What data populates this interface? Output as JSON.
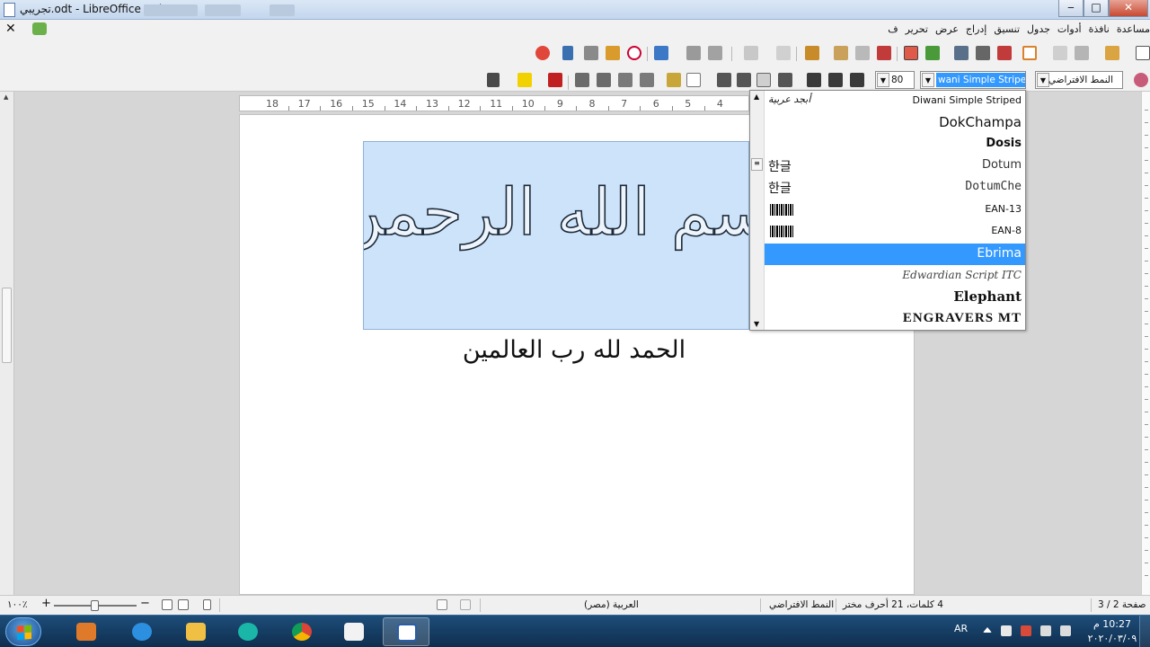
{
  "window": {
    "title": "تجريبي.odt - LibreOffice Writer",
    "min": "‒",
    "max": "□",
    "close": "✕"
  },
  "menu": {
    "close_doc": "✕",
    "items": [
      "ف",
      "تحرير",
      "عرض",
      "إدراج",
      "تنسيق",
      "جدول",
      "أدوات",
      "نافذة",
      "مساعدة"
    ]
  },
  "format_bar": {
    "paragraph_style": "النمط الافتراضي",
    "font_name": "wani Simple Striped",
    "font_size": "80"
  },
  "ruler": {
    "labels": [
      "18",
      "17",
      "16",
      "15",
      "14",
      "13",
      "12",
      "11",
      "10",
      "9",
      "8",
      "7",
      "6",
      "5",
      "4"
    ]
  },
  "document": {
    "frame_text": "بسم الله الرحمن الرحيم",
    "line2": "الحمد لله رب العالمين"
  },
  "font_dropdown": {
    "selected": "Ebrima",
    "items": [
      {
        "name": "Diwani Simple Striped",
        "sample": "أبجد عربية"
      },
      {
        "name": "DokChampa",
        "sample": ""
      },
      {
        "name": "Dosis",
        "sample": ""
      },
      {
        "name": "Dotum",
        "sample": "한글"
      },
      {
        "name": "DotumChe",
        "sample": "한글"
      },
      {
        "name": "EAN-13",
        "sample": "barcode"
      },
      {
        "name": "EAN-8",
        "sample": "barcode"
      },
      {
        "name": "Ebrima",
        "sample": ""
      },
      {
        "name": "Edwardian Script ITC",
        "sample": ""
      },
      {
        "name": "Elephant",
        "sample": ""
      },
      {
        "name": "ENGRAVERS MT",
        "sample": ""
      }
    ]
  },
  "status": {
    "page": "صفحة 2 / 3",
    "words": "4 كلمات، 21 أحرف مختر",
    "style": "النمط الافتراضي",
    "language": "العربية (مصر)",
    "zoom": "١٠٠٪",
    "zoom_minus": "−",
    "zoom_plus": "+"
  },
  "taskbar": {
    "lang": "AR",
    "time": "10:27 م",
    "date": "٢٠٢٠/٠٣/٠٩"
  }
}
